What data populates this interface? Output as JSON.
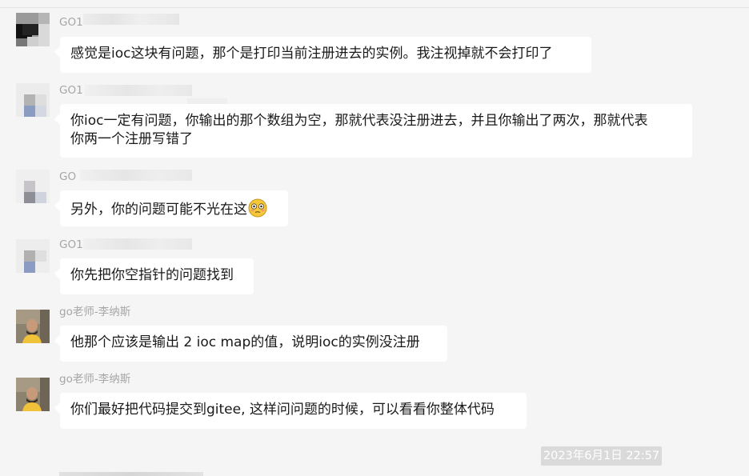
{
  "messages": [
    {
      "sender": "GO1",
      "text": "感觉是ioc这块有问题，那个是打印当前注册进去的实例。我注视掉就不会打印了"
    },
    {
      "sender": "GO1",
      "text_lines": [
        "你ioc一定有问题，你输出的那个数组为空，那就代表没注册进去，并且你输出了两次，那就代表",
        "你两一个注册写错了"
      ]
    },
    {
      "sender": "GO",
      "text": "另外，你的问题可能不光在这",
      "emoji": "flushed-face-emoji"
    },
    {
      "sender": "GO1",
      "text": "你先把你空指针的问题找到"
    },
    {
      "sender": "go老师-李纳斯",
      "text": "他那个应该是输出 2 ioc map的值，说明ioc的实例没注册"
    },
    {
      "sender": "go老师-李纳斯",
      "text": "你们最好把代码提交到gitee, 这样问问题的时候，可以看看你整体代码"
    }
  ],
  "timestamp": "2023年6月1日 22:57",
  "colors": {
    "background": "#f5f5f5",
    "bubble": "#ffffff",
    "timestamp_bg": "#dadada",
    "sender_text": "#a6a6a6"
  }
}
